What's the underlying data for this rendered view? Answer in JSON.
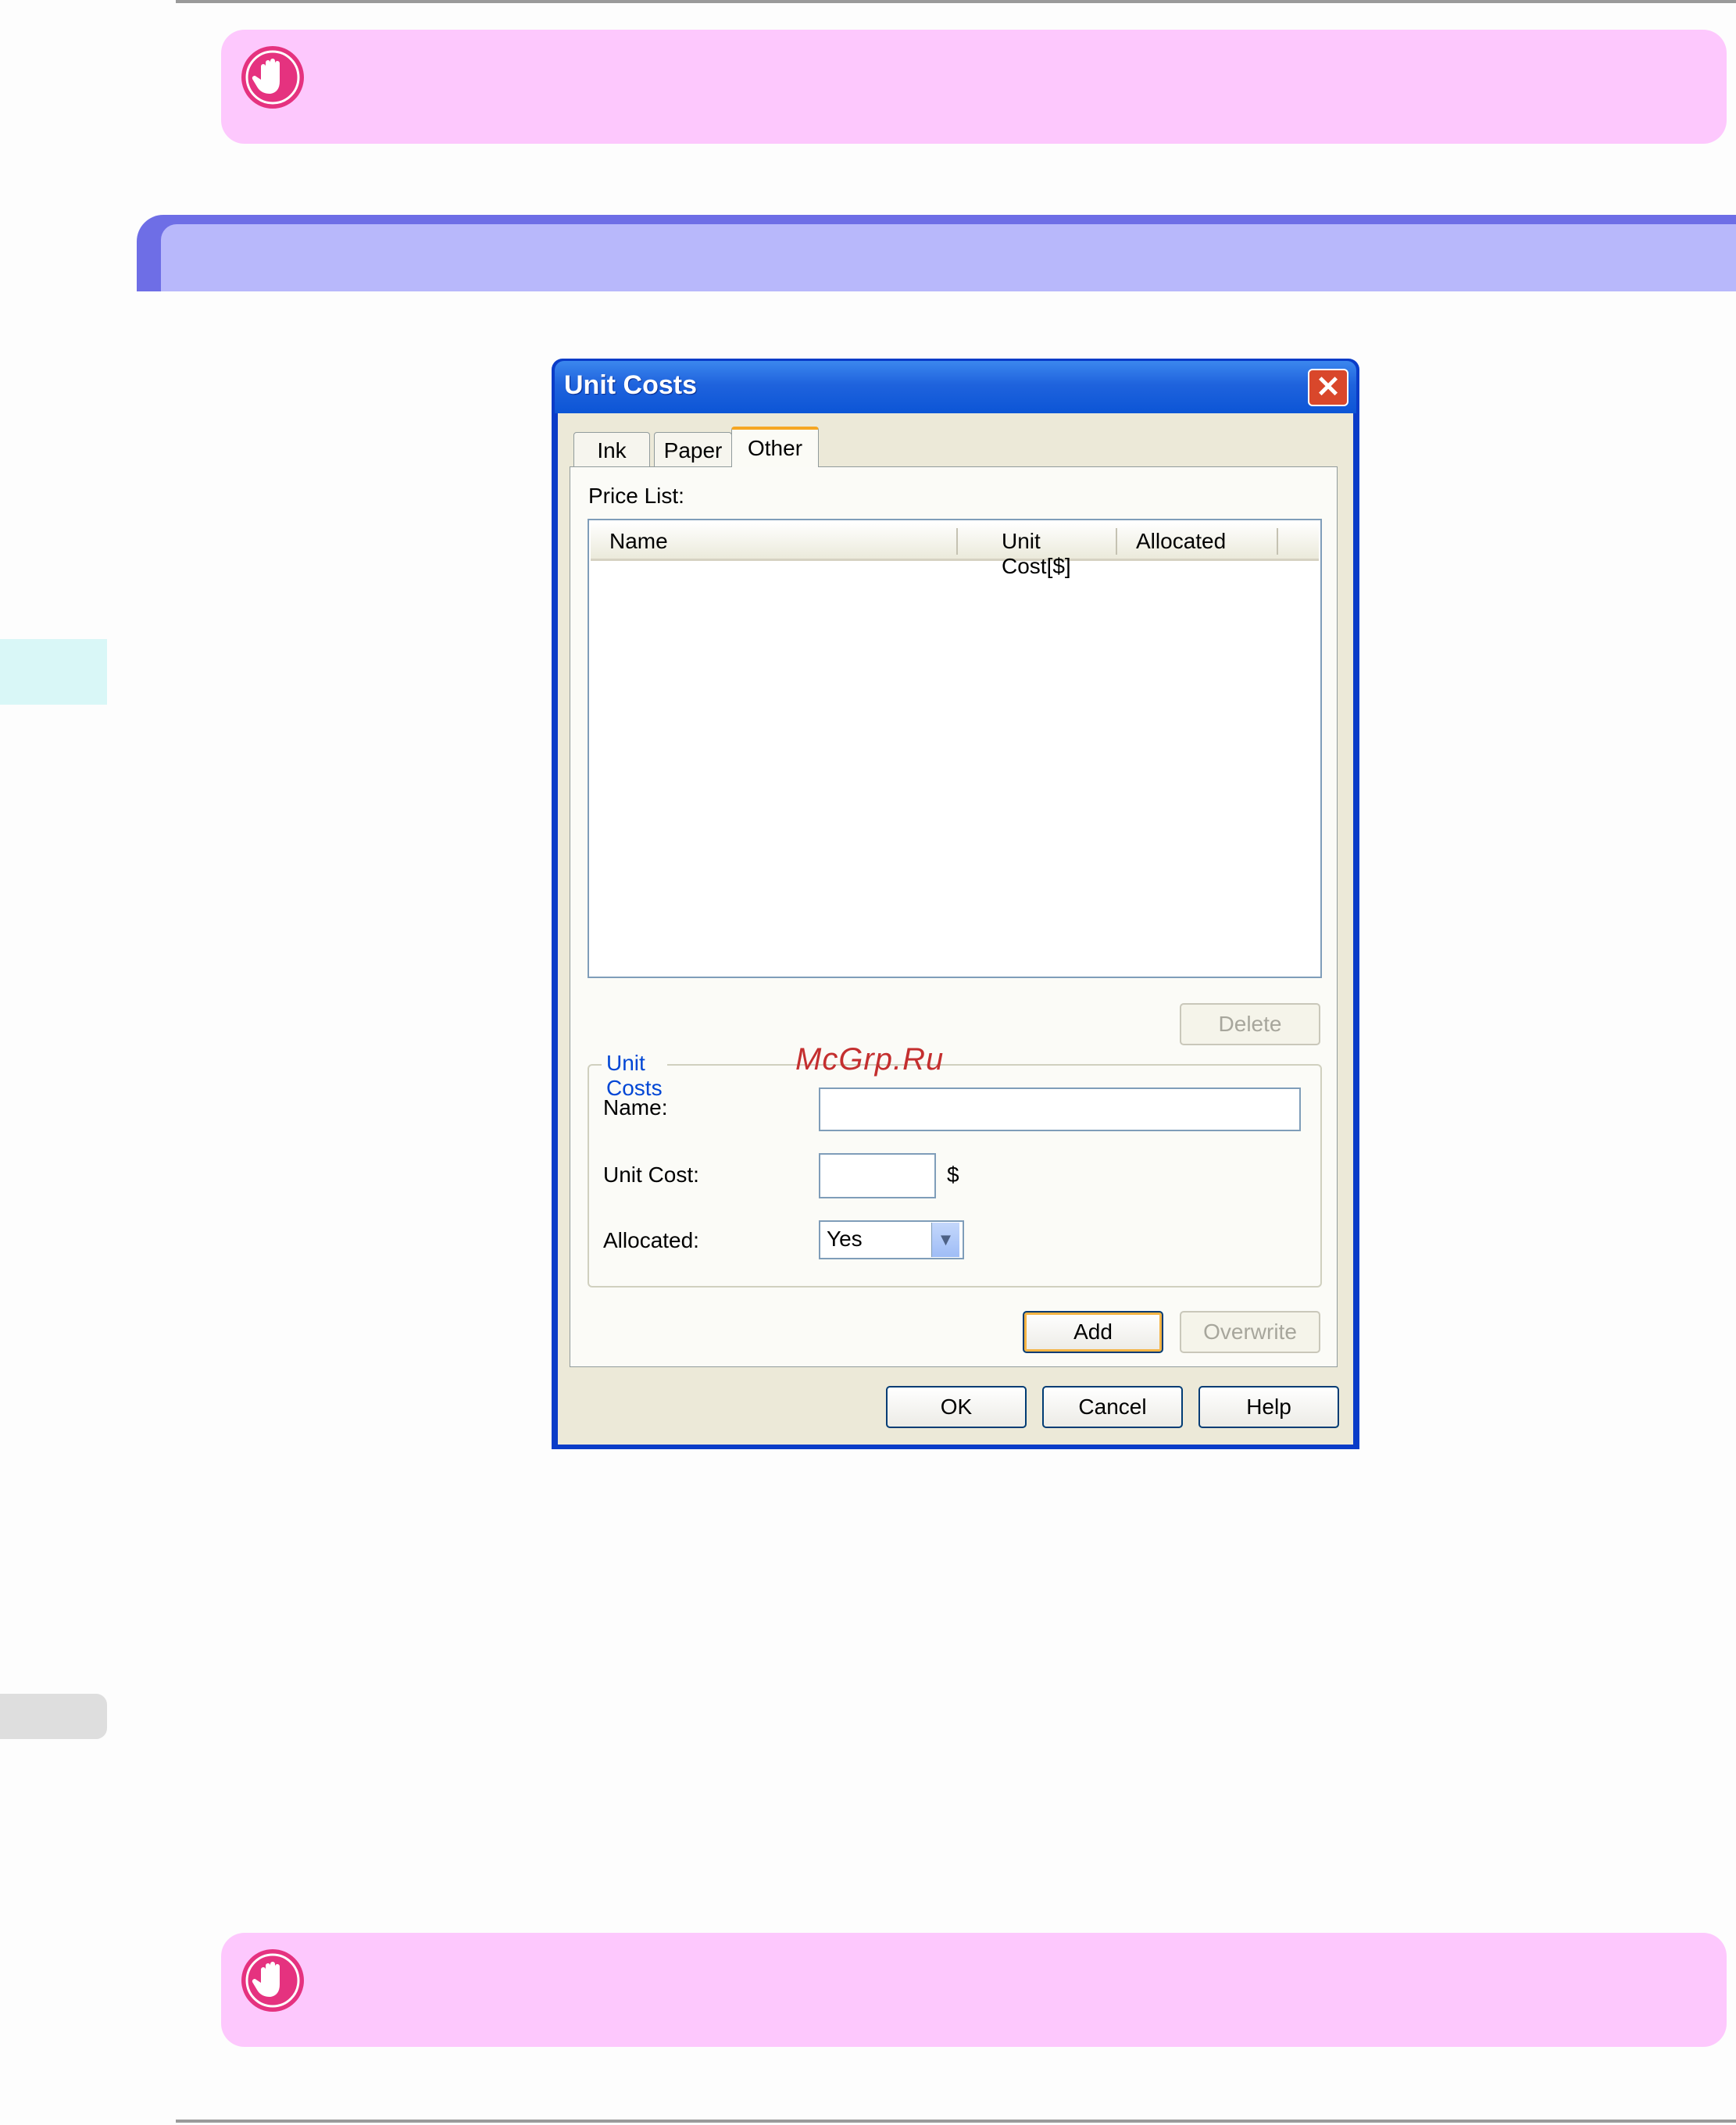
{
  "dialog": {
    "title": "Unit Costs",
    "close_glyph": "✕",
    "tabs": [
      {
        "label": "Ink",
        "active": false
      },
      {
        "label": "Paper",
        "active": false
      },
      {
        "label": "Other",
        "active": true
      }
    ],
    "price_list_label": "Price List:",
    "columns": [
      "Name",
      "Unit Cost[$]",
      "Allocated"
    ],
    "rows": [],
    "delete_label": "Delete",
    "group": {
      "title": "Unit Costs",
      "name_label": "Name:",
      "name_value": "",
      "unit_cost_label": "Unit Cost:",
      "unit_cost_value": "",
      "currency": "$",
      "allocated_label": "Allocated:",
      "allocated_value": "Yes"
    },
    "add_label": "Add",
    "overwrite_label": "Overwrite",
    "ok_label": "OK",
    "cancel_label": "Cancel",
    "help_label": "Help"
  },
  "watermark": "McGrp.Ru",
  "colors": {
    "note_background": "#fdc8fd",
    "note_icon": "#e5327f",
    "section_head": "#6e6ee6",
    "section_head_inner": "#b8b8fb",
    "titlebar": "#0c55d6"
  }
}
